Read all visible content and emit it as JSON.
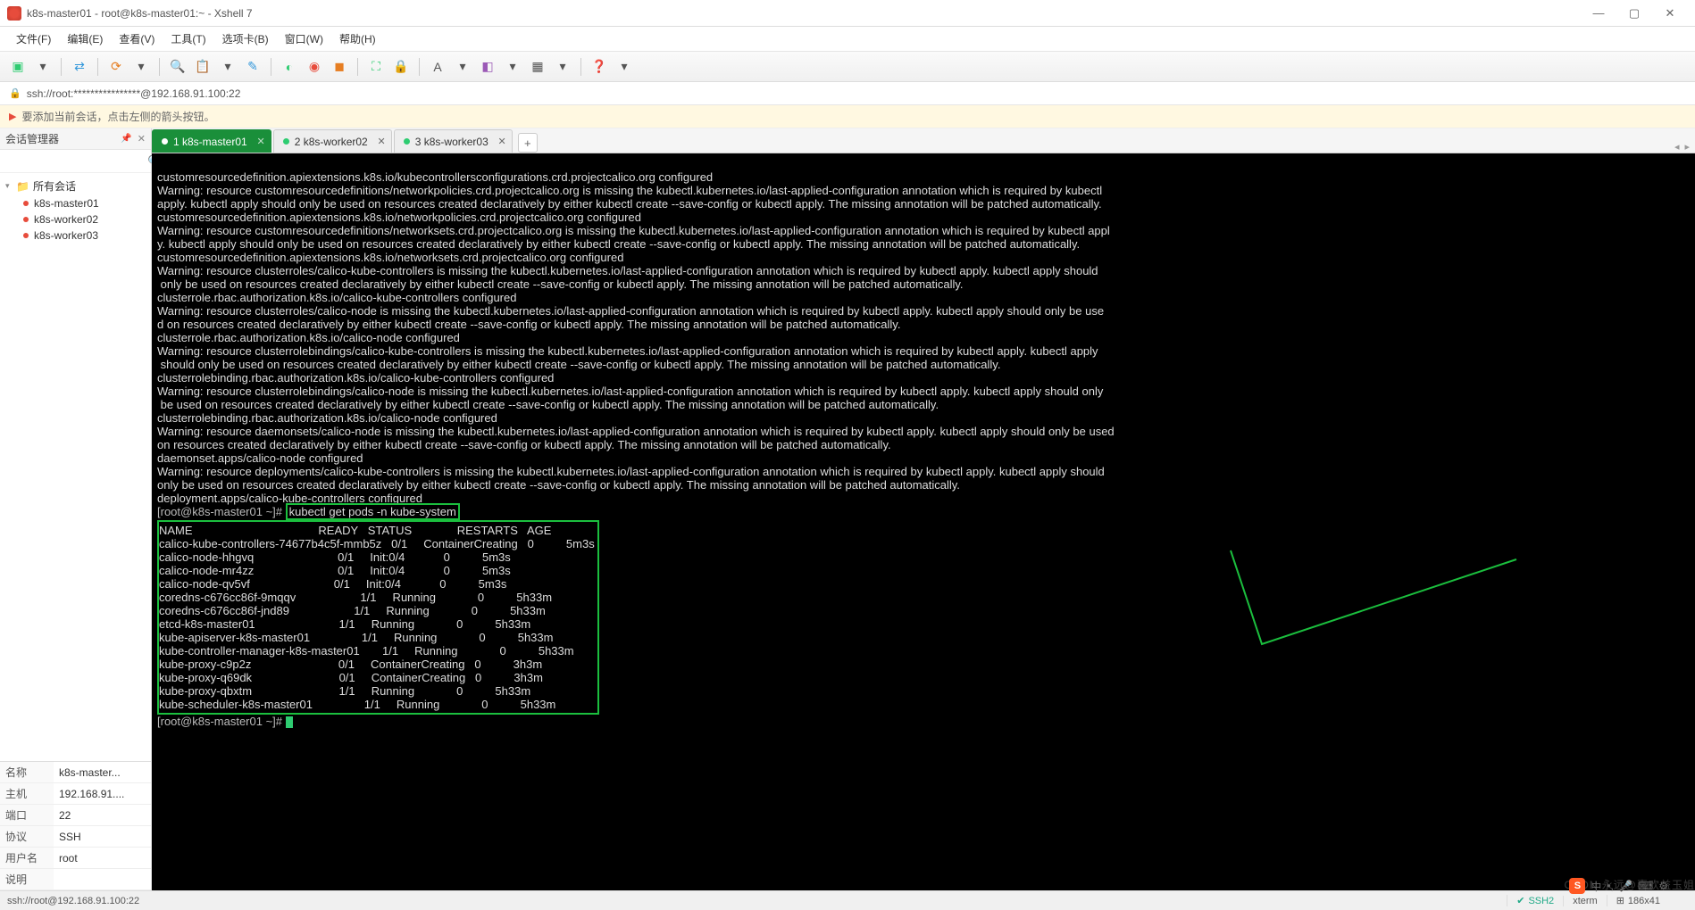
{
  "window": {
    "title": "k8s-master01 - root@k8s-master01:~ - Xshell 7"
  },
  "menus": [
    "文件(F)",
    "编辑(E)",
    "查看(V)",
    "工具(T)",
    "选项卡(B)",
    "窗口(W)",
    "帮助(H)"
  ],
  "address": "ssh://root:****************@192.168.91.100:22",
  "hint": "要添加当前会话，点击左侧的箭头按钮。",
  "sidebar": {
    "title": "会话管理器",
    "root": "所有会话",
    "items": [
      "k8s-master01",
      "k8s-worker02",
      "k8s-worker03"
    ]
  },
  "props": {
    "name_label": "名称",
    "name_value": "k8s-master...",
    "host_label": "主机",
    "host_value": "192.168.91....",
    "port_label": "端口",
    "port_value": "22",
    "proto_label": "协议",
    "proto_value": "SSH",
    "user_label": "用户名",
    "user_value": "root",
    "desc_label": "说明",
    "desc_value": ""
  },
  "tabs": {
    "t1": "1 k8s-master01",
    "t2": "2 k8s-worker02",
    "t3": "3 k8s-worker03",
    "add": "+"
  },
  "term": {
    "lines": [
      "customresourcedefinition.apiextensions.k8s.io/kubecontrollersconfigurations.crd.projectcalico.org configured",
      "Warning: resource customresourcedefinitions/networkpolicies.crd.projectcalico.org is missing the kubectl.kubernetes.io/last-applied-configuration annotation which is required by kubectl",
      "apply. kubectl apply should only be used on resources created declaratively by either kubectl create --save-config or kubectl apply. The missing annotation will be patched automatically.",
      "customresourcedefinition.apiextensions.k8s.io/networkpolicies.crd.projectcalico.org configured",
      "Warning: resource customresourcedefinitions/networksets.crd.projectcalico.org is missing the kubectl.kubernetes.io/last-applied-configuration annotation which is required by kubectl appl",
      "y. kubectl apply should only be used on resources created declaratively by either kubectl create --save-config or kubectl apply. The missing annotation will be patched automatically.",
      "customresourcedefinition.apiextensions.k8s.io/networksets.crd.projectcalico.org configured",
      "Warning: resource clusterroles/calico-kube-controllers is missing the kubectl.kubernetes.io/last-applied-configuration annotation which is required by kubectl apply. kubectl apply should",
      " only be used on resources created declaratively by either kubectl create --save-config or kubectl apply. The missing annotation will be patched automatically.",
      "clusterrole.rbac.authorization.k8s.io/calico-kube-controllers configured",
      "Warning: resource clusterroles/calico-node is missing the kubectl.kubernetes.io/last-applied-configuration annotation which is required by kubectl apply. kubectl apply should only be use",
      "d on resources created declaratively by either kubectl create --save-config or kubectl apply. The missing annotation will be patched automatically.",
      "clusterrole.rbac.authorization.k8s.io/calico-node configured",
      "Warning: resource clusterrolebindings/calico-kube-controllers is missing the kubectl.kubernetes.io/last-applied-configuration annotation which is required by kubectl apply. kubectl apply",
      " should only be used on resources created declaratively by either kubectl create --save-config or kubectl apply. The missing annotation will be patched automatically.",
      "clusterrolebinding.rbac.authorization.k8s.io/calico-kube-controllers configured",
      "Warning: resource clusterrolebindings/calico-node is missing the kubectl.kubernetes.io/last-applied-configuration annotation which is required by kubectl apply. kubectl apply should only",
      " be used on resources created declaratively by either kubectl create --save-config or kubectl apply. The missing annotation will be patched automatically.",
      "clusterrolebinding.rbac.authorization.k8s.io/calico-node configured",
      "Warning: resource daemonsets/calico-node is missing the kubectl.kubernetes.io/last-applied-configuration annotation which is required by kubectl apply. kubectl apply should only be used ",
      "on resources created declaratively by either kubectl create --save-config or kubectl apply. The missing annotation will be patched automatically.",
      "daemonset.apps/calico-node configured",
      "Warning: resource deployments/calico-kube-controllers is missing the kubectl.kubernetes.io/last-applied-configuration annotation which is required by kubectl apply. kubectl apply should ",
      "only be used on resources created declaratively by either kubectl create --save-config or kubectl apply. The missing annotation will be patched automatically.",
      "deployment.apps/calico-kube-controllers configured"
    ],
    "prompt": "[root@k8s-master01 ~]# ",
    "command": "kubectl get pods -n kube-system",
    "table_header": "NAME                                       READY   STATUS              RESTARTS   AGE  ",
    "table_rows": [
      "calico-kube-controllers-74677b4c5f-mmb5z   0/1     ContainerCreating   0          5m3s ",
      "calico-node-hhgvq                          0/1     Init:0/4            0          5m3s ",
      "calico-node-mr4zz                          0/1     Init:0/4            0          5m3s ",
      "calico-node-qv5vf                          0/1     Init:0/4            0          5m3s ",
      "coredns-c676cc86f-9mqqv                    1/1     Running             0          5h33m",
      "coredns-c676cc86f-jnd89                    1/1     Running             0          5h33m",
      "etcd-k8s-master01                          1/1     Running             0          5h33m",
      "kube-apiserver-k8s-master01                1/1     Running             0          5h33m",
      "kube-controller-manager-k8s-master01       1/1     Running             0          5h33m",
      "kube-proxy-c9p2z                           0/1     ContainerCreating   0          3h3m ",
      "kube-proxy-q69dk                           0/1     ContainerCreating   0          3h3m ",
      "kube-proxy-qbxtm                           1/1     Running             0          5h33m",
      "kube-scheduler-k8s-master01                1/1     Running             0          5h33m"
    ],
    "prompt2": "[root@k8s-master01 ~]# "
  },
  "status": {
    "left": "ssh://root@192.168.91.100:22",
    "ssh": "SSH2",
    "term": "xterm",
    "size": "186x41",
    "pos_icon": "⌖"
  },
  "watermark": "CSDN 永远@喜欢益玉姐"
}
